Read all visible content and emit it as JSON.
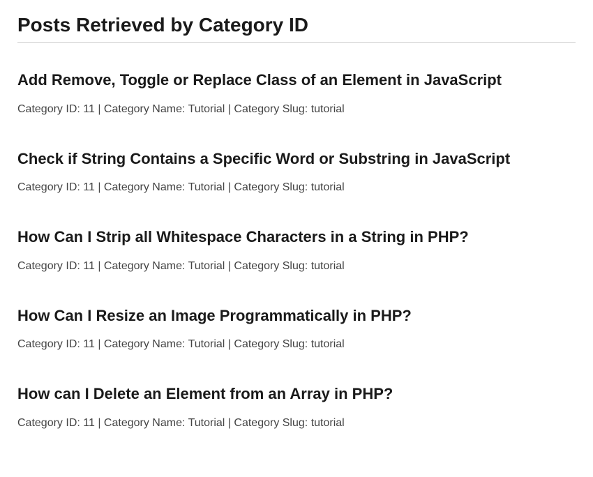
{
  "pageTitle": "Posts Retrieved by Category ID",
  "metaLabels": {
    "categoryId": "Category ID:",
    "categoryName": "Category Name:",
    "categorySlug": "Category Slug:",
    "separator": " | "
  },
  "posts": [
    {
      "title": "Add Remove, Toggle or Replace Class of an Element in JavaScript",
      "categoryId": "11",
      "categoryName": "Tutorial",
      "categorySlug": "tutorial"
    },
    {
      "title": "Check if String Contains a Specific Word or Substring in JavaScript",
      "categoryId": "11",
      "categoryName": "Tutorial",
      "categorySlug": "tutorial"
    },
    {
      "title": "How Can I Strip all Whitespace Characters in a String in PHP?",
      "categoryId": "11",
      "categoryName": "Tutorial",
      "categorySlug": "tutorial"
    },
    {
      "title": "How Can I Resize an Image Programmatically in PHP?",
      "categoryId": "11",
      "categoryName": "Tutorial",
      "categorySlug": "tutorial"
    },
    {
      "title": "How can I Delete an Element from an Array in PHP?",
      "categoryId": "11",
      "categoryName": "Tutorial",
      "categorySlug": "tutorial"
    }
  ]
}
